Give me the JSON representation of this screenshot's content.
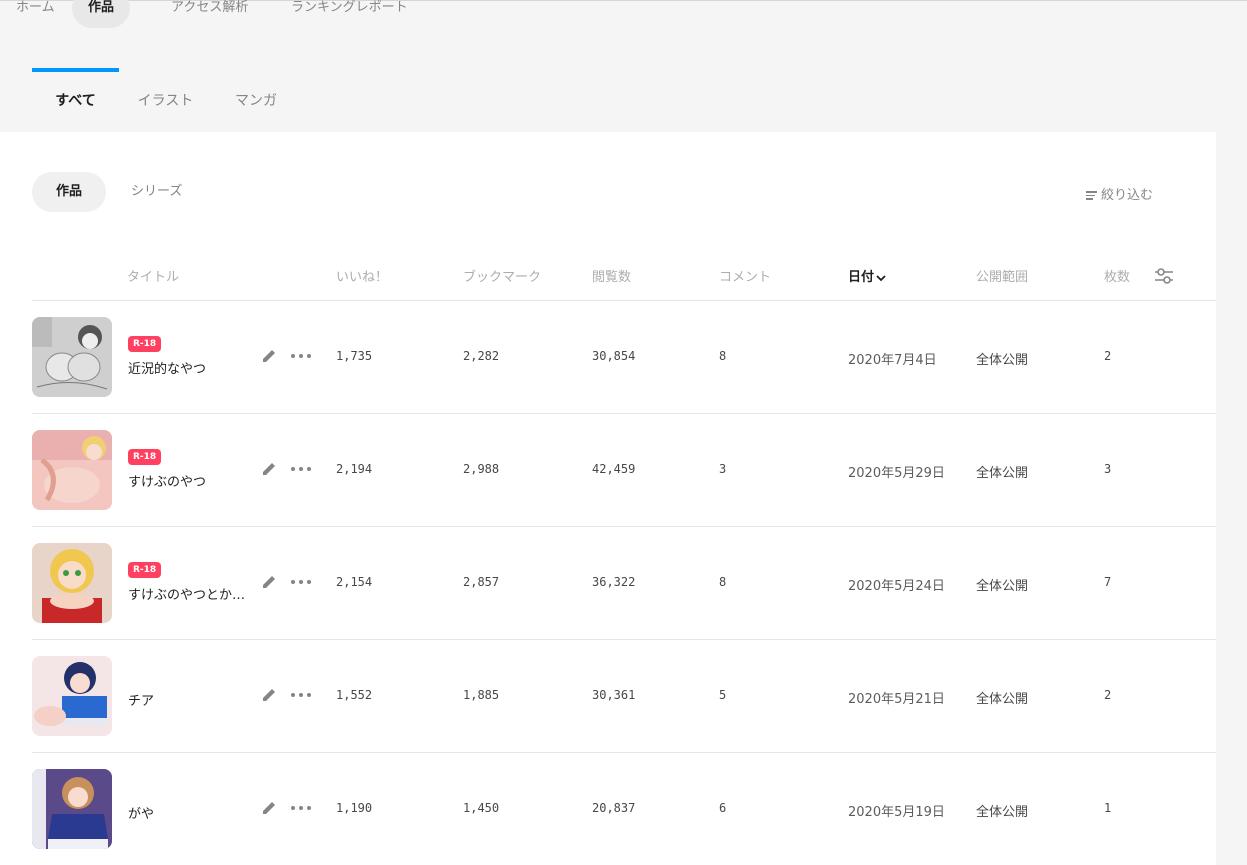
{
  "top_nav": [
    {
      "label": "ホーム",
      "active": false
    },
    {
      "label": "作品",
      "active": true
    },
    {
      "label": "アクセス解析",
      "active": false
    },
    {
      "label": "ランキングレポート",
      "active": false
    }
  ],
  "type_tabs": [
    {
      "label": "すべて",
      "active": true
    },
    {
      "label": "イラスト",
      "active": false
    },
    {
      "label": "マンガ",
      "active": false
    }
  ],
  "sub_tabs": [
    {
      "label": "作品",
      "active": true
    },
    {
      "label": "シリーズ",
      "active": false
    }
  ],
  "filter_label": "絞り込む",
  "columns": {
    "title": "タイトル",
    "likes": "いいね！",
    "bookmarks": "ブックマーク",
    "views": "閲覧数",
    "comments": "コメント",
    "date": "日付",
    "visibility": "公開範囲",
    "pages": "枚数"
  },
  "sorted_column": "date",
  "works": [
    {
      "r18": true,
      "badge": "R-18",
      "title": "近況的なやつ",
      "likes": "1,735",
      "bookmarks": "2,282",
      "views": "30,854",
      "comments": "8",
      "date": "2020年7月4日",
      "visibility": "全体公開",
      "pages": "2"
    },
    {
      "r18": true,
      "badge": "R-18",
      "title": "すけぶのやつ",
      "likes": "2,194",
      "bookmarks": "2,988",
      "views": "42,459",
      "comments": "3",
      "date": "2020年5月29日",
      "visibility": "全体公開",
      "pages": "3"
    },
    {
      "r18": true,
      "badge": "R-18",
      "title": "すけぶのやつとかな...",
      "likes": "2,154",
      "bookmarks": "2,857",
      "views": "36,322",
      "comments": "8",
      "date": "2020年5月24日",
      "visibility": "全体公開",
      "pages": "7"
    },
    {
      "r18": false,
      "badge": "",
      "title": "チア",
      "likes": "1,552",
      "bookmarks": "1,885",
      "views": "30,361",
      "comments": "5",
      "date": "2020年5月21日",
      "visibility": "全体公開",
      "pages": "2"
    },
    {
      "r18": false,
      "badge": "",
      "title": "がや",
      "likes": "1,190",
      "bookmarks": "1,450",
      "views": "20,837",
      "comments": "6",
      "date": "2020年5月19日",
      "visibility": "全体公開",
      "pages": "1"
    }
  ],
  "colors": {
    "accent": "#0096fa",
    "r18_badge": "#ff4060"
  },
  "icons": [
    "edit-icon",
    "more-icon",
    "settings-icon",
    "filter-icon",
    "chevron-down-icon"
  ]
}
